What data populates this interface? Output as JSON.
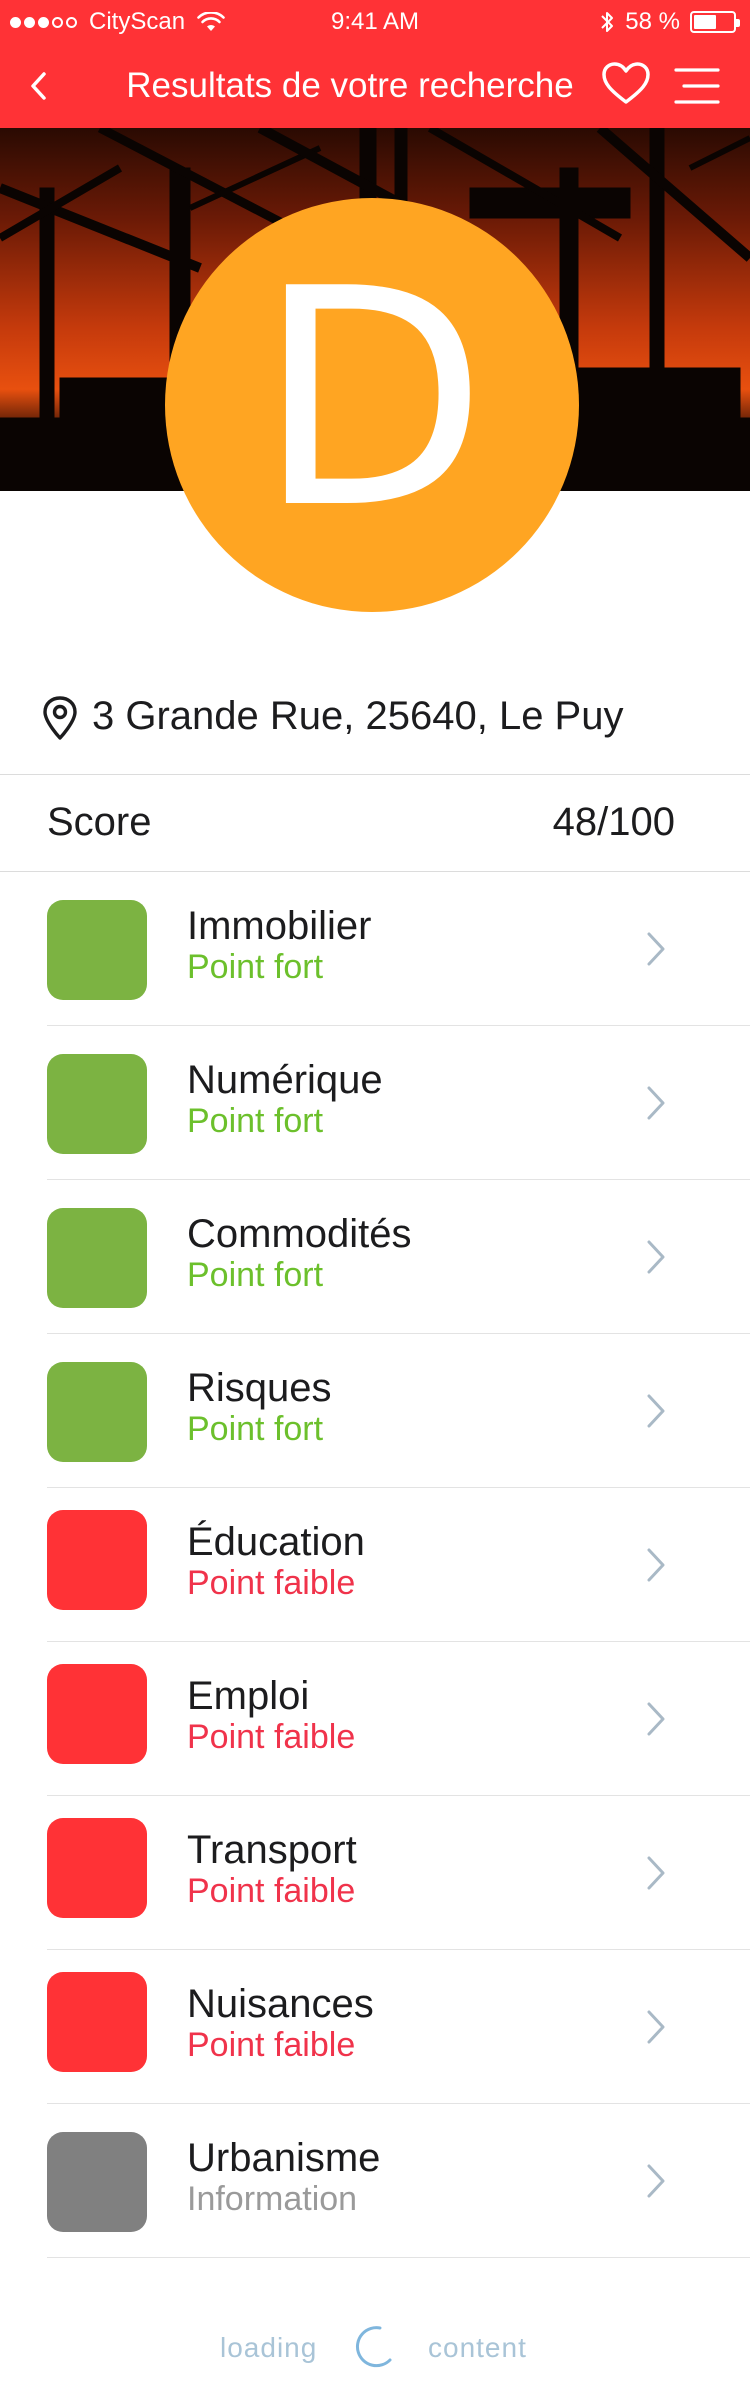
{
  "status_bar": {
    "carrier": "CityScan",
    "time": "9:41 AM",
    "battery": "58 %",
    "battery_level": 0.58,
    "signal_bars_filled": 3,
    "signal_bars_total": 5
  },
  "nav": {
    "title": "Resultats de votre recherche",
    "back_icon": "chevron-left-icon",
    "favorite_icon": "heart-icon",
    "menu_icon": "menu-icon"
  },
  "hero": {
    "grade": "D",
    "grade_color": "#ffa522"
  },
  "address": {
    "icon": "map-pin-icon",
    "text": "3 Grande Rue, 25640, Le Puy"
  },
  "score": {
    "label": "Score",
    "value": "48/100"
  },
  "colors": {
    "primary": "#ff3236",
    "strong": "#7cb342",
    "strong_text": "#6cc02c",
    "weak": "#ff3236",
    "weak_text": "#f0334b",
    "info": "#808080",
    "info_text": "#9a9a9a",
    "chevron": "#a9b9c6"
  },
  "categories": [
    {
      "name": "Immobilier",
      "status": "Point fort",
      "kind": "strong"
    },
    {
      "name": "Numérique",
      "status": "Point fort",
      "kind": "strong"
    },
    {
      "name": "Commodités",
      "status": "Point fort",
      "kind": "strong"
    },
    {
      "name": "Risques",
      "status": "Point fort",
      "kind": "strong"
    },
    {
      "name": "Éducation",
      "status": "Point faible",
      "kind": "weak"
    },
    {
      "name": "Emploi",
      "status": "Point faible",
      "kind": "weak"
    },
    {
      "name": "Transport",
      "status": "Point faible",
      "kind": "weak"
    },
    {
      "name": "Nuisances",
      "status": "Point faible",
      "kind": "weak"
    },
    {
      "name": "Urbanisme",
      "status": "Information",
      "kind": "info"
    }
  ],
  "loading": {
    "left": "loading",
    "right": "content"
  }
}
